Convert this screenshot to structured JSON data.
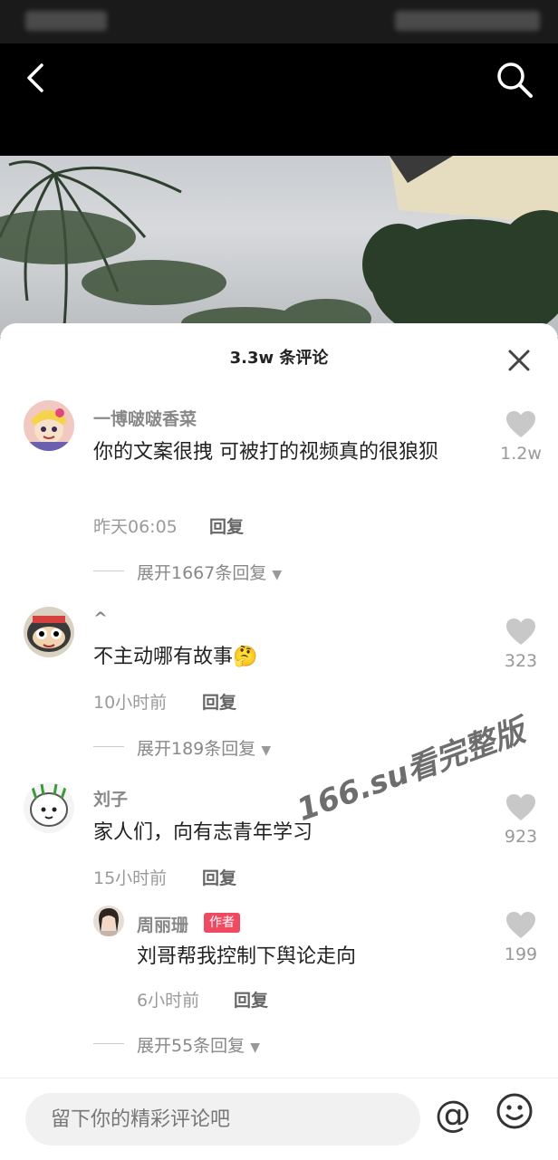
{
  "header": {
    "back_icon": "chevron-left-icon",
    "search_icon": "search-icon"
  },
  "comments_panel": {
    "title": "3.3w 条评论",
    "close_icon": "close-icon",
    "comments": [
      {
        "username": "一博啵啵香菜",
        "text": "你的文案很拽 可被打的视频真的很狼狈",
        "time": "昨天06:05",
        "reply_label": "回复",
        "likes": "1.2w",
        "expand_label": "展开1667条回复"
      },
      {
        "username": "^",
        "text": "不主动哪有故事🤔",
        "time": "10小时前",
        "reply_label": "回复",
        "likes": "323",
        "expand_label": "展开189条回复"
      },
      {
        "username": "刘子",
        "text": "家人们，向有志青年学习",
        "time": "15小时前",
        "reply_label": "回复",
        "likes": "923",
        "replies": [
          {
            "username": "周丽珊",
            "badge": "作者",
            "text": "刘哥帮我控制下舆论走向",
            "time": "6小时前",
            "reply_label": "回复",
            "likes": "199"
          }
        ],
        "expand_label": "展开55条回复"
      }
    ],
    "watermark": "166.su看完整版"
  },
  "composer": {
    "placeholder": "留下你的精彩评论吧",
    "at_icon": "at-icon",
    "emoji_icon": "emoji-icon"
  }
}
